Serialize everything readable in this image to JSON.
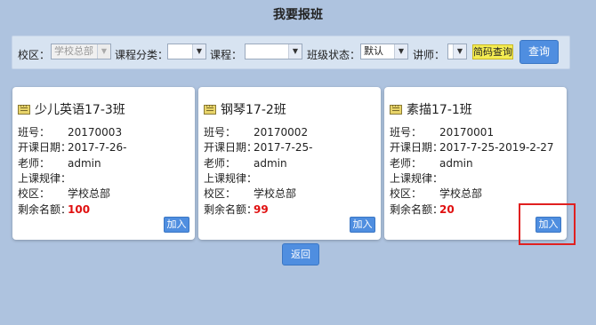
{
  "page_title": "我要报班",
  "filters": {
    "campus": {
      "label": "校区：",
      "value": "学校总部"
    },
    "category": {
      "label": "课程分类：",
      "value": ""
    },
    "course": {
      "label": "课程：",
      "value": ""
    },
    "status": {
      "label": "班级状态：",
      "value": "默认"
    },
    "teacher": {
      "label": "讲师：",
      "value": ""
    },
    "barcode_label": "简码查询",
    "query_label": "查询"
  },
  "field_labels": {
    "class_no": "班号：",
    "start_date": "开课日期：",
    "teacher": "老师：",
    "schedule": "上课规律：",
    "campus": "校区：",
    "remaining": "剩余名额："
  },
  "classes": [
    {
      "title": "少儿英语17-3班",
      "class_no": "20170003",
      "start_date": "2017-7-26-",
      "teacher": "admin",
      "schedule": "",
      "campus": "学校总部",
      "remaining": "100",
      "join_label": "加入"
    },
    {
      "title": "钢琴17-2班",
      "class_no": "20170002",
      "start_date": "2017-7-25-",
      "teacher": "admin",
      "schedule": "",
      "campus": "学校总部",
      "remaining": "99",
      "join_label": "加入"
    },
    {
      "title": "素描17-1班",
      "class_no": "20170001",
      "start_date": "2017-7-25-2019-2-27",
      "teacher": "admin",
      "schedule": "",
      "campus": "学校总部",
      "remaining": "20",
      "join_label": "加入"
    }
  ],
  "back_label": "返回",
  "colors": {
    "background": "#aec3df",
    "button": "#4f8ee0",
    "remaining_highlight": "#e01010",
    "callout_border": "#e02020"
  }
}
